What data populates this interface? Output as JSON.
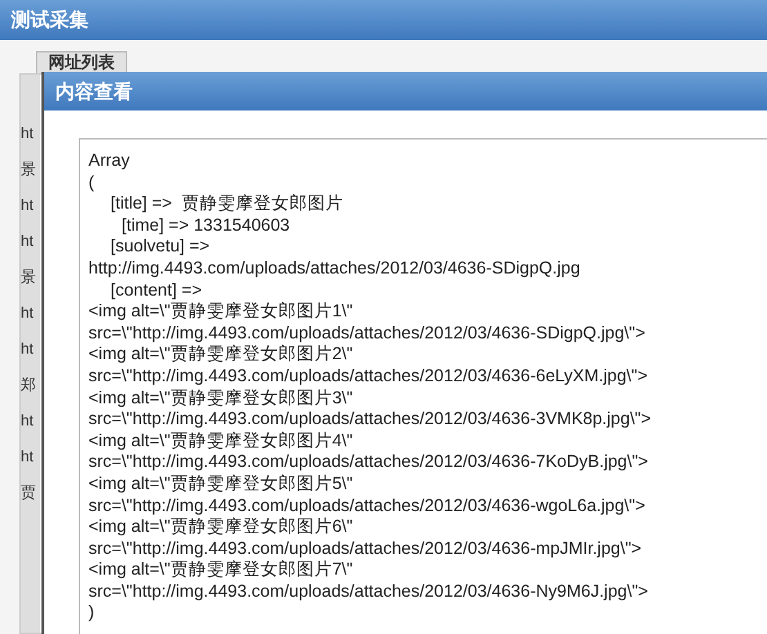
{
  "window": {
    "title": "测试采集"
  },
  "background": {
    "tab": "网址列表",
    "column_1": [
      "ht",
      "景",
      "ht",
      "ht",
      "景",
      "ht",
      "ht",
      "郑",
      "ht",
      "ht",
      "贾"
    ]
  },
  "dialog": {
    "title": "内容查看",
    "lines": [
      {
        "kind": "plain",
        "text": "Array"
      },
      {
        "kind": "plain",
        "text": "("
      },
      {
        "kind": "key",
        "text": "[title] =>  贾静雯摩登女郎图片"
      },
      {
        "kind": "subkey",
        "text": "[time] => 1331540603"
      },
      {
        "kind": "key",
        "text": "[suolvetu] =>"
      },
      {
        "kind": "plain",
        "text": "http://img.4493.com/uploads/attaches/2012/03/4636-SDigpQ.jpg"
      },
      {
        "kind": "key",
        "text": "[content] =>"
      },
      {
        "kind": "plain",
        "text": "<img alt=\\\"贾静雯摩登女郎图片1\\\""
      },
      {
        "kind": "plain",
        "text": "src=\\\"http://img.4493.com/uploads/attaches/2012/03/4636-SDigpQ.jpg\\\">"
      },
      {
        "kind": "plain",
        "text": "<img alt=\\\"贾静雯摩登女郎图片2\\\""
      },
      {
        "kind": "plain",
        "text": "src=\\\"http://img.4493.com/uploads/attaches/2012/03/4636-6eLyXM.jpg\\\">"
      },
      {
        "kind": "plain",
        "text": "<img alt=\\\"贾静雯摩登女郎图片3\\\""
      },
      {
        "kind": "plain",
        "text": "src=\\\"http://img.4493.com/uploads/attaches/2012/03/4636-3VMK8p.jpg\\\">"
      },
      {
        "kind": "plain",
        "text": "<img alt=\\\"贾静雯摩登女郎图片4\\\""
      },
      {
        "kind": "plain",
        "text": "src=\\\"http://img.4493.com/uploads/attaches/2012/03/4636-7KoDyB.jpg\\\">"
      },
      {
        "kind": "plain",
        "text": "<img alt=\\\"贾静雯摩登女郎图片5\\\""
      },
      {
        "kind": "plain",
        "text": "src=\\\"http://img.4493.com/uploads/attaches/2012/03/4636-wgoL6a.jpg\\\">"
      },
      {
        "kind": "plain",
        "text": "<img alt=\\\"贾静雯摩登女郎图片6\\\""
      },
      {
        "kind": "plain",
        "text": "src=\\\"http://img.4493.com/uploads/attaches/2012/03/4636-mpJMIr.jpg\\\">"
      },
      {
        "kind": "plain",
        "text": "<img alt=\\\"贾静雯摩登女郎图片7\\\""
      },
      {
        "kind": "plain",
        "text": "src=\\\"http://img.4493.com/uploads/attaches/2012/03/4636-Ny9M6J.jpg\\\">"
      },
      {
        "kind": "plain",
        "text": ")"
      }
    ]
  }
}
